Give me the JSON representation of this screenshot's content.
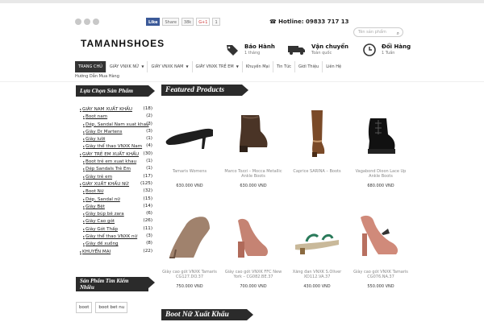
{
  "header": {
    "social": [
      "facebook-icon",
      "twitter-icon",
      "google-plus-icon"
    ],
    "share": {
      "like": "Like",
      "share": "Share",
      "count": "38k",
      "gplus": "G+1",
      "gcount": "1"
    },
    "hotline_label": "Hotline: 09833 717 13",
    "search_placeholder": "Tên sản phẩm",
    "logo": {
      "part1": "TAMANH",
      "part2": "SHOES"
    },
    "features": [
      {
        "title": "Bảo Hành",
        "sub": "1 tháng"
      },
      {
        "title": "Vận chuyển",
        "sub": "Toàn quốc"
      },
      {
        "title": "Đổi Hàng",
        "sub": "1 Tuần"
      }
    ]
  },
  "nav": {
    "items": [
      "TRANG CHỦ",
      "GIÀY VNXK NỮ",
      "GIÀY VNXK NAM",
      "GIÀY VNXK TRẺ EM",
      "Khuyến Mại",
      "Tin Tức",
      "Giới Thiệu",
      "Liên Hệ"
    ],
    "second_row": "Hướng Dẫn Mua Hàng"
  },
  "sidebar": {
    "categories_title": "Lựa Chọn Sản Phẩm",
    "categories": [
      {
        "label": "GIÀY NAM XUẤT KHẨU",
        "count": "(18)",
        "level": "parent"
      },
      {
        "label": "Boot nam",
        "count": "(2)",
        "level": "child"
      },
      {
        "label": "Dép, Sandal Nam xuat khau",
        "count": "(3)",
        "level": "child"
      },
      {
        "label": "Giày Dr Martens",
        "count": "(3)",
        "level": "child"
      },
      {
        "label": "Giày lười",
        "count": "(1)",
        "level": "child"
      },
      {
        "label": "Giày thể thao VNXK Nam",
        "count": "(4)",
        "level": "child"
      },
      {
        "label": "GIÀY TRẺ EM XUẤT KHẨU",
        "count": "(30)",
        "level": "parent"
      },
      {
        "label": "Boot trẻ em xuat khau",
        "count": "(1)",
        "level": "child"
      },
      {
        "label": "Dép Sandals Trẻ Em",
        "count": "(1)",
        "level": "child"
      },
      {
        "label": "Giày trẻ em",
        "count": "(17)",
        "level": "child"
      },
      {
        "label": "GIÀY XUẤT KHẨU NỮ",
        "count": "(125)",
        "level": "parent"
      },
      {
        "label": "Boot Nữ",
        "count": "(32)",
        "level": "child"
      },
      {
        "label": "Dép, Sandal nữ",
        "count": "(15)",
        "level": "child"
      },
      {
        "label": "Giày Bệt",
        "count": "(14)",
        "level": "child"
      },
      {
        "label": "Giày búp bê zara",
        "count": "(6)",
        "level": "child"
      },
      {
        "label": "Giày Cao gót",
        "count": "(26)",
        "level": "child"
      },
      {
        "label": "Giày Gót Thấp",
        "count": "(11)",
        "level": "child"
      },
      {
        "label": "Giày thể thao VNXK nữ",
        "count": "(3)",
        "level": "child"
      },
      {
        "label": "Giày đế xuồng",
        "count": "(8)",
        "level": "child"
      },
      {
        "label": "KHUYẾN MẠI",
        "count": "(22)",
        "level": "parent"
      }
    ],
    "popular_title_1": "Sản Phẩm Tìm Kiếm",
    "popular_title_2": "Nhiều",
    "tags": [
      "boot",
      "boot bet nu"
    ]
  },
  "main": {
    "featured_title": "Featured Products",
    "second_title": "Boot Nữ Xuất Khẩu",
    "products": [
      {
        "name": "Tamaris Womens",
        "price": "630.000 VND",
        "icon": "black-heel-pump-icon"
      },
      {
        "name": "Marco Tozzi – Mocca Metallic Ankle Boots",
        "price": "630.000 VND",
        "icon": "brown-ankle-boot-icon"
      },
      {
        "name": "Caprice SARINA – Boots",
        "price": "",
        "icon": "tall-brown-boot-icon"
      },
      {
        "name": "Vagabond Dioon Lace Up Ankle Boots",
        "price": "680.000 VND",
        "icon": "black-lace-up-boot-icon"
      },
      {
        "name": "Giày cao gót VNXK Tamaris CG127.DO.37",
        "price": "750.000 VND",
        "icon": "beige-stiletto-icon"
      },
      {
        "name": "Giày cao gót VNXK FFC New York – CG082.BE.37",
        "price": "700.000 VND",
        "icon": "pink-block-heel-icon"
      },
      {
        "name": "Xăng đan VNXK S.Oliver XD112.VA.37",
        "price": "430.000 VND",
        "icon": "strap-sandal-icon"
      },
      {
        "name": "Giày cao gót VNXK Tamaris CG076.NA.37",
        "price": "550.000 VND",
        "icon": "pink-heel-bow-icon"
      }
    ]
  }
}
